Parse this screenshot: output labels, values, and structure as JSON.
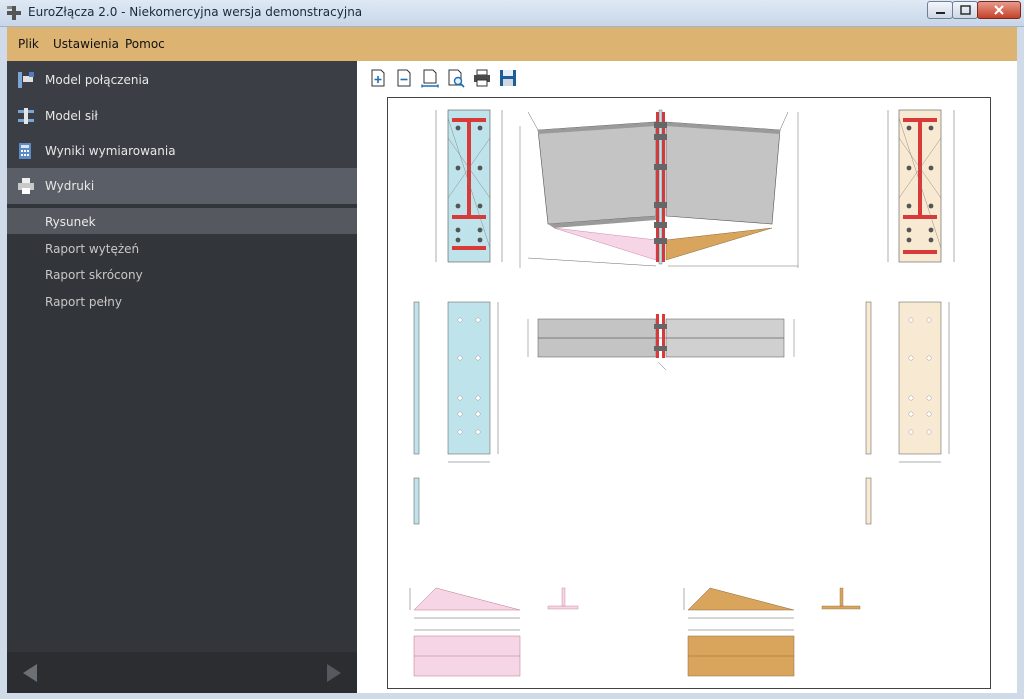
{
  "window": {
    "title": "EuroZłącza 2.0 - Niekomercyjna wersja demonstracyjna"
  },
  "menu": {
    "items": [
      "Plik",
      "Ustawienia",
      "Pomoc"
    ]
  },
  "sidebar": {
    "nav": [
      {
        "label": "Model połączenia",
        "icon": "connection-model-icon"
      },
      {
        "label": "Model sił",
        "icon": "forces-model-icon"
      },
      {
        "label": "Wyniki wymiarowania",
        "icon": "calculator-icon"
      },
      {
        "label": "Wydruki",
        "icon": "printer-icon",
        "active": true
      }
    ],
    "sub": [
      {
        "label": "Rysunek",
        "active": true
      },
      {
        "label": "Raport wytężeń"
      },
      {
        "label": "Raport skrócony"
      },
      {
        "label": "Raport pełny"
      }
    ]
  },
  "toolbar": {
    "icons": [
      "new-page-icon",
      "remove-page-icon",
      "fit-width-icon",
      "zoom-page-icon",
      "print-icon",
      "save-icon"
    ]
  },
  "colors": {
    "menubar": "#ddb372",
    "sidebar": "#3b3e44",
    "left_plate": "#bfe3ea",
    "right_plate": "#f8ead2",
    "beam": "#c4c4c4",
    "flange_red": "#d83a3a",
    "rib_left": "#f6d6e6",
    "rib_right": "#d9a55c"
  }
}
